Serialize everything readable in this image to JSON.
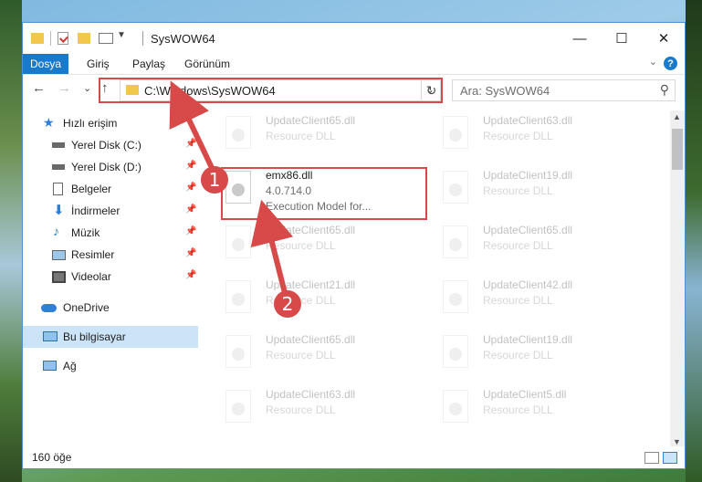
{
  "title": "SysWOW64",
  "window_controls": {
    "minimize": "—",
    "maximize": "☐",
    "close": "✕"
  },
  "ribbon": {
    "file_tab": "Dosya",
    "tabs": [
      "Giriş",
      "Paylaş",
      "Görünüm"
    ],
    "help": "?",
    "collapse": "⌄"
  },
  "nav": {
    "back": "←",
    "forward": "→",
    "recent": "⌄",
    "up": "↑",
    "address": "C:\\Windows\\SysWOW64",
    "address_drop": "⌄",
    "refresh": "↻",
    "search_placeholder": "Ara: SysWOW64",
    "search_glyph": "⚲"
  },
  "sidebar": {
    "quick_access": "Hızlı erişim",
    "items": [
      {
        "label": "Yerel Disk (C:)",
        "pinned": true
      },
      {
        "label": "Yerel Disk (D:)",
        "pinned": true
      },
      {
        "label": "Belgeler",
        "pinned": true
      },
      {
        "label": "İndirmeler",
        "pinned": true
      },
      {
        "label": "Müzik",
        "pinned": true
      },
      {
        "label": "Resimler",
        "pinned": true
      },
      {
        "label": "Videolar",
        "pinned": true
      }
    ],
    "onedrive": "OneDrive",
    "this_pc": "Bu bilgisayar",
    "network": "Ağ",
    "pin_glyph": "📌"
  },
  "files": {
    "left": [
      {
        "name": "UpdateClient65.dll",
        "desc": "Resource DLL"
      },
      {
        "name": "emx86.dll",
        "version": "4.0.714.0",
        "desc": "Execution Model for..."
      },
      {
        "name": "UpdateClient65.dll",
        "desc": "Resource DLL"
      },
      {
        "name": "UpdateClient21.dll",
        "desc": "Resource DLL"
      },
      {
        "name": "UpdateClient65.dll",
        "desc": "Resource DLL"
      },
      {
        "name": "UpdateClient63.dll",
        "desc": "Resource DLL"
      }
    ],
    "right": [
      {
        "name": "UpdateClient63.dll",
        "desc": "Resource DLL"
      },
      {
        "name": "UpdateClient19.dll",
        "desc": "Resource DLL"
      },
      {
        "name": "UpdateClient65.dll",
        "desc": "Resource DLL"
      },
      {
        "name": "UpdateClient42.dll",
        "desc": "Resource DLL"
      },
      {
        "name": "UpdateClient19.dll",
        "desc": "Resource DLL"
      },
      {
        "name": "UpdateClient5.dll",
        "desc": "Resource DLL"
      }
    ]
  },
  "status": {
    "count": "160 öğe"
  },
  "callouts": [
    "1",
    "2"
  ],
  "colors": {
    "accent": "#1979ca",
    "highlight": "#d84a4a",
    "folder": "#f1c84b"
  }
}
